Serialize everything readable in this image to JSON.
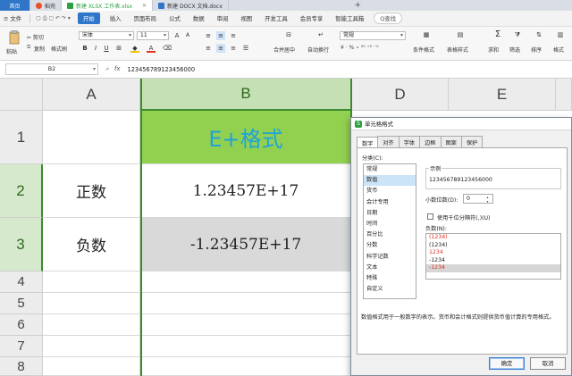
{
  "tabs": {
    "home": "首页",
    "items": [
      {
        "label": "稻壳",
        "icon": "daoke-icon",
        "color": "#e8502a"
      },
      {
        "label": "新建 XLSX 工作表.xlsx",
        "icon": "sheet-icon",
        "color": "#2ea043"
      },
      {
        "label": "新建 DOCX 文档.docx",
        "icon": "doc-icon",
        "color": "#2f75c8"
      }
    ],
    "add": "+"
  },
  "menu": {
    "file": "≡ 文件",
    "items": [
      "开始",
      "插入",
      "页面布局",
      "公式",
      "数据",
      "审阅",
      "视图",
      "开发工具",
      "会员专享",
      "智能工具箱"
    ],
    "search": "Q查找"
  },
  "ribbon": {
    "paste": "粘贴",
    "cut": "✂ 剪切",
    "copy": "复制",
    "format_painter": "格式刷",
    "font_name": "宋体",
    "font_size": "11",
    "merge": "合并居中",
    "wrap": "自动换行",
    "number_format": "常规",
    "cond_format": "条件格式",
    "table_style": "表格样式",
    "sum": "求和",
    "filter": "筛选",
    "sort": "排序",
    "fill": "格式"
  },
  "formula_bar": {
    "cell_ref": "B2",
    "fx": "fx",
    "content": "123456789123456000"
  },
  "columns": [
    "A",
    "B",
    "D",
    "E"
  ],
  "rows": [
    "1",
    "2",
    "3",
    "4",
    "5",
    "6",
    "7",
    "8"
  ],
  "cells": {
    "b1": "E+格式",
    "a2": "正数",
    "b2": "1.23457E+17",
    "a3": "负数",
    "b3": "-1.23457E+17"
  },
  "colors": {
    "header_fill": "#92d050",
    "header_text": "#1fa3d8",
    "selection": "#3c8a2d"
  },
  "dialog": {
    "title": "单元格格式",
    "tabs": [
      "数字",
      "对齐",
      "字体",
      "边框",
      "图案",
      "保护"
    ],
    "category_label": "分类(C):",
    "categories": [
      "常规",
      "数值",
      "货币",
      "会计专用",
      "日期",
      "时间",
      "百分比",
      "分数",
      "科学记数",
      "文本",
      "特殊",
      "自定义"
    ],
    "selected_category": "数值",
    "sample_label": "示例",
    "sample_value": "123456789123456000",
    "decimals_label": "小数位数(D):",
    "decimals_value": "0",
    "thousands_label": "使用千位分隔符(,)(U)",
    "negative_label": "负数(N):",
    "negative_options": [
      {
        "text": "(1234)",
        "red": true
      },
      {
        "text": "(1234)",
        "red": false
      },
      {
        "text": "1234",
        "red": true
      },
      {
        "text": "-1234",
        "red": false
      },
      {
        "text": "-1234",
        "red": true
      }
    ],
    "description": "数值格式用于一般数字的表示。货币和会计格式则提供货币值计算的专用格式。",
    "ok": "确定",
    "cancel": "取消"
  }
}
